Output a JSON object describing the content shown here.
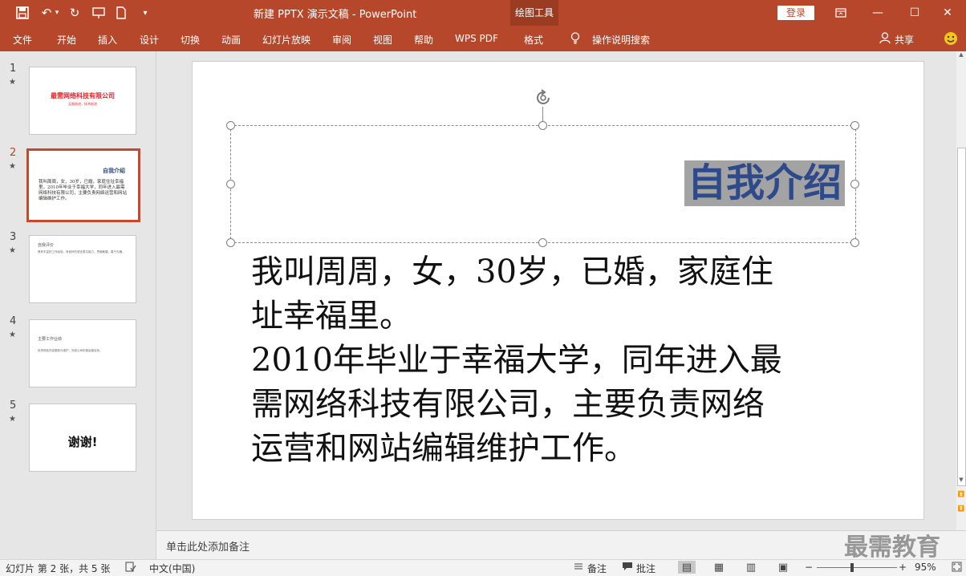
{
  "window": {
    "title": "新建 PPTX 演示文稿  -  PowerPoint",
    "context_tab": "绘图工具",
    "login_label": "登录"
  },
  "ribbon": {
    "tabs": [
      "文件",
      "开始",
      "插入",
      "设计",
      "切换",
      "动画",
      "幻灯片放映",
      "审阅",
      "视图",
      "帮助",
      "WPS PDF",
      "格式"
    ],
    "active_tab": "格式",
    "tell_me": "操作说明搜索",
    "share": "共享"
  },
  "slides": [
    {
      "number": "1",
      "star": "★",
      "title": "最需网络科技有限公司",
      "subtitle": "无限前进，技术前进"
    },
    {
      "number": "2",
      "star": "★",
      "title": "自我介绍",
      "body": "我叫周周，女，30岁，已婚，家庭住址幸福里。2010年毕业于幸福大学，同年进入最需网络科技有限公司，主要负责网络运营和网站编辑维护工作。"
    },
    {
      "number": "3",
      "star": "★",
      "title": "自我评价",
      "body": "具有丰富的工作经验，有良好的语言表达能力，思维敏捷，善于沟通。"
    },
    {
      "number": "4",
      "star": "★",
      "title": "主要工作业绩",
      "body": "负责网站内容更新与维护，完成公司年度运营目标。"
    },
    {
      "number": "5",
      "star": "★",
      "title": "谢谢!"
    }
  ],
  "current_slide": {
    "title": "自我介绍",
    "body_lines": [
      "我叫周周，女，30岁，已婚，家庭住",
      "址幸福里。",
      "2010年毕业于幸福大学，同年进入最",
      "需网络科技有限公司，主要负责网络",
      "运营和网站编辑维护工作。"
    ]
  },
  "notes_placeholder": "单击此处添加备注",
  "status": {
    "slide_info": "幻灯片 第 2 张，共 5 张",
    "language": "中文(中国)",
    "notes_btn": "备注",
    "comments_btn": "批注",
    "zoom": "95%"
  },
  "watermark": "最需教育",
  "colors": {
    "accent": "#b7472a",
    "title_text": "#2e4a8a",
    "thumb_title_red": "#e0252b"
  }
}
